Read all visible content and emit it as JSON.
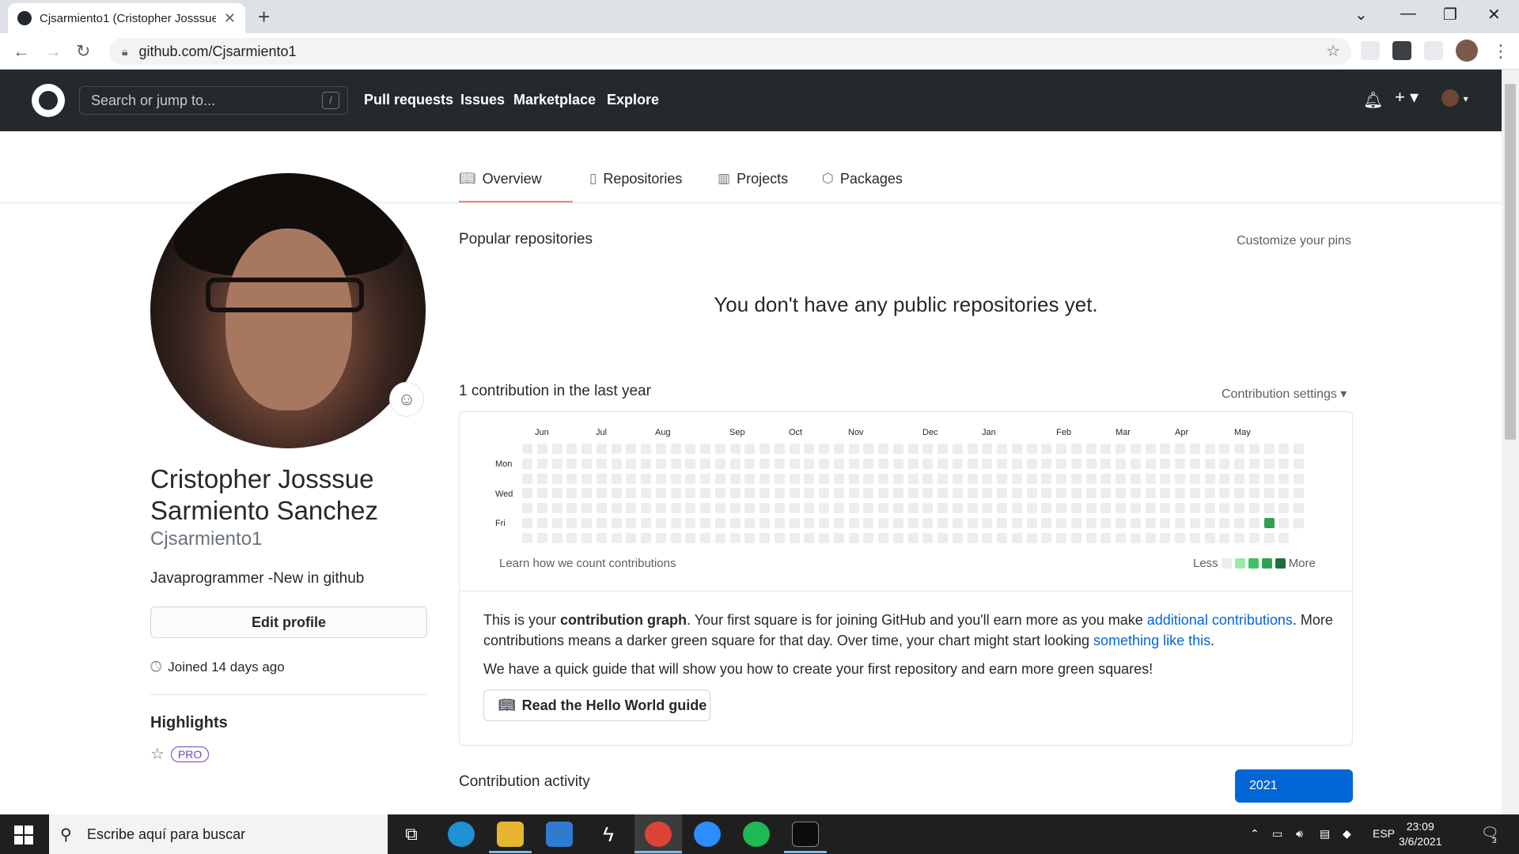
{
  "browser": {
    "tab_title": "Cjsarmiento1 (Cristopher Josssue",
    "url": "github.com/Cjsarmiento1"
  },
  "header": {
    "search_placeholder": "Search or jump to...",
    "search_shortcut": "/",
    "nav": [
      "Pull requests",
      "Issues",
      "Marketplace",
      "Explore"
    ]
  },
  "tabs": [
    {
      "label": "Overview",
      "icon": "book-icon",
      "active": true
    },
    {
      "label": "Repositories",
      "icon": "repo-icon"
    },
    {
      "label": "Projects",
      "icon": "project-icon"
    },
    {
      "label": "Packages",
      "icon": "package-icon"
    }
  ],
  "profile": {
    "full_name": "Cristopher Josssue Sarmiento Sanchez",
    "username": "Cjsarmiento1",
    "bio": "Javaprogrammer -New in github",
    "edit_button": "Edit profile",
    "joined": "Joined 14 days ago",
    "highlights_title": "Highlights",
    "pro_badge": "PRO"
  },
  "main": {
    "popular_title": "Popular repositories",
    "customize_pins": "Customize your pins",
    "no_repos": "You don't have any public repositories yet.",
    "contrib_title": "1 contribution in the last year",
    "contrib_settings": "Contribution settings ▾",
    "learn_link": "Learn how we count contributions",
    "legend_less": "Less",
    "legend_more": "More",
    "explain_a": "This is your ",
    "explain_bold": "contribution graph",
    "explain_b": ". Your first square is for joining GitHub and you'll earn more as you make ",
    "explain_link1": "additional contributions",
    "explain_c": ". More contributions means a darker green square for that day. Over time, your chart might start looking ",
    "explain_link2": "something like this",
    "explain_d": ".",
    "guide_text": "We have a quick guide that will show you how to create your first repository and earn more green squares!",
    "guide_button": "Read the Hello World guide",
    "activity_title": "Contribution activity",
    "year_button": "2021"
  },
  "calendar": {
    "months": [
      "Jun",
      "Jul",
      "Aug",
      "Sep",
      "Oct",
      "Nov",
      "Dec",
      "Jan",
      "Feb",
      "Mar",
      "Apr",
      "May"
    ],
    "days": [
      "Mon",
      "Wed",
      "Fri"
    ],
    "weeks": 53,
    "contribution_week": 50,
    "contribution_day": 5,
    "contribution_count": 1,
    "last_week_days": 6
  },
  "colors": {
    "empty": "#ebedf0",
    "level1": "#9be9a8",
    "level2": "#40c463",
    "level3": "#30a14e",
    "level4": "#216e39",
    "header_bg": "#24292e",
    "link": "#0366d6"
  },
  "taskbar": {
    "search_placeholder": "Escribe aquí para buscar",
    "language": "ESP",
    "time": "23:09",
    "date": "3/6/2021",
    "notifications": "3"
  }
}
